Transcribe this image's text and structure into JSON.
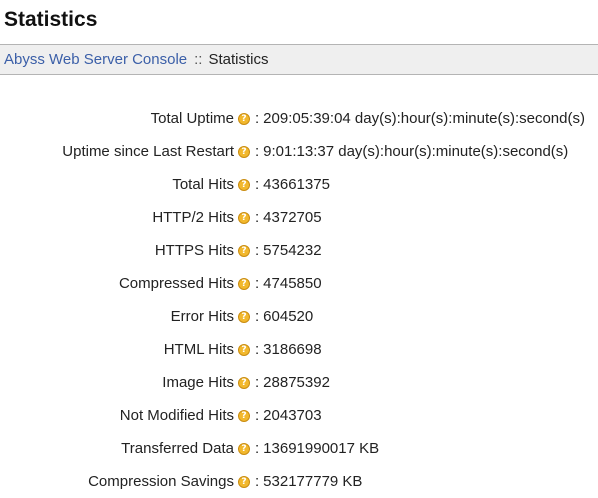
{
  "page": {
    "title": "Statistics"
  },
  "breadcrumb": {
    "root_link": "Abyss Web Server Console",
    "separator": "::",
    "current": "Statistics"
  },
  "stats": {
    "colon": ":",
    "help_glyph": "?",
    "rows": [
      {
        "label": "Total Uptime",
        "value": "209:05:39:04 day(s):hour(s):minute(s):second(s)"
      },
      {
        "label": "Uptime since Last Restart",
        "value": "9:01:13:37 day(s):hour(s):minute(s):second(s)"
      },
      {
        "label": "Total Hits",
        "value": "43661375"
      },
      {
        "label": "HTTP/2 Hits",
        "value": "4372705"
      },
      {
        "label": "HTTPS Hits",
        "value": "5754232"
      },
      {
        "label": "Compressed Hits",
        "value": "4745850"
      },
      {
        "label": "Error Hits",
        "value": "604520"
      },
      {
        "label": "HTML Hits",
        "value": "3186698"
      },
      {
        "label": "Image Hits",
        "value": "28875392"
      },
      {
        "label": "Not Modified Hits",
        "value": "2043703"
      },
      {
        "label": "Transferred Data",
        "value": "13691990017 KB"
      },
      {
        "label": "Compression Savings",
        "value": "532177779 KB"
      }
    ]
  },
  "colors": {
    "link": "#3b5fa8",
    "breadcrumb_background": "#efefef",
    "help_icon": "#f2b82d"
  },
  "icons": {
    "help": "help-icon"
  }
}
